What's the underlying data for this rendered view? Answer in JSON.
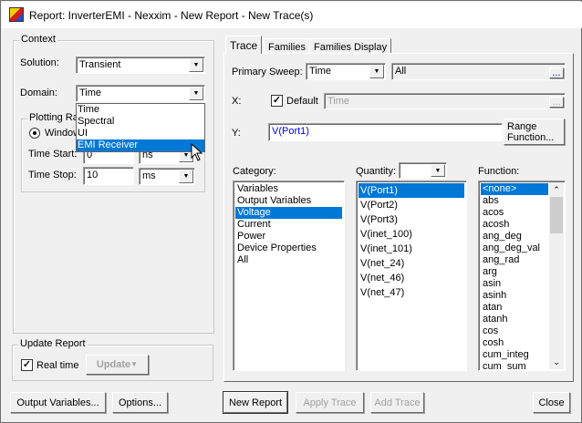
{
  "window": {
    "title": "Report: InverterEMI - Nexxim - New Report - New Trace(s)"
  },
  "context": {
    "label": "Context",
    "solution_label": "Solution:",
    "solution_value": "Transient",
    "domain_label": "Domain:",
    "domain_value": "Time",
    "domain_options": [
      "Time",
      "Spectral",
      "UI",
      "EMI Receiver"
    ],
    "domain_highlighted": "EMI Receiver",
    "plotting_range_label": "Plotting Ra",
    "window_radio_label": "Window",
    "time_start_label": "Time Start:",
    "time_start_value": "0",
    "time_start_unit": "ns",
    "time_stop_label": "Time Stop:",
    "time_stop_value": "10",
    "time_stop_unit": "ms"
  },
  "update_report": {
    "label": "Update Report",
    "realtime_label": "Real time",
    "realtime_checked": true,
    "update_button": "Update"
  },
  "tabs": [
    {
      "label": "Trace",
      "active": true
    },
    {
      "label": "Families"
    },
    {
      "label": "Families Display"
    }
  ],
  "trace": {
    "primary_sweep_label": "Primary Sweep:",
    "primary_sweep_value": "Time",
    "sweep_range_value": "All",
    "ellipsis": "...",
    "x_label": "X:",
    "default_label": "Default",
    "default_checked": true,
    "x_value": "Time",
    "y_label": "Y:",
    "y_value": "V(Port1)",
    "range_function_button": "Range\nFunction...",
    "category_label": "Category:",
    "categories": [
      "Variables",
      "Output Variables",
      "Voltage",
      "Current",
      "Power",
      "Device Properties",
      "All"
    ],
    "category_selected": "Voltage",
    "quantity_label": "Quantity:",
    "quantities": [
      "V(Port1)",
      "V(Port2)",
      "V(Port3)",
      "V(inet_100)",
      "V(inet_101)",
      "V(net_24)",
      "V(net_46)",
      "V(net_47)"
    ],
    "quantity_selected": "V(Port1)",
    "function_label": "Function:",
    "functions": [
      "<none>",
      "abs",
      "acos",
      "acosh",
      "ang_deg",
      "ang_deg_val",
      "ang_rad",
      "arg",
      "asin",
      "asinh",
      "atan",
      "atanh",
      "cos",
      "cosh",
      "cum_integ",
      "cum_sum"
    ],
    "function_selected": "<none>"
  },
  "buttons": {
    "output_variables": "Output Variables...",
    "options": "Options...",
    "new_report": "New Report",
    "apply_trace": "Apply Trace",
    "add_trace": "Add Trace",
    "close": "Close"
  },
  "colors": {
    "selection": "#0078d7",
    "y_text": "#0000ff"
  }
}
